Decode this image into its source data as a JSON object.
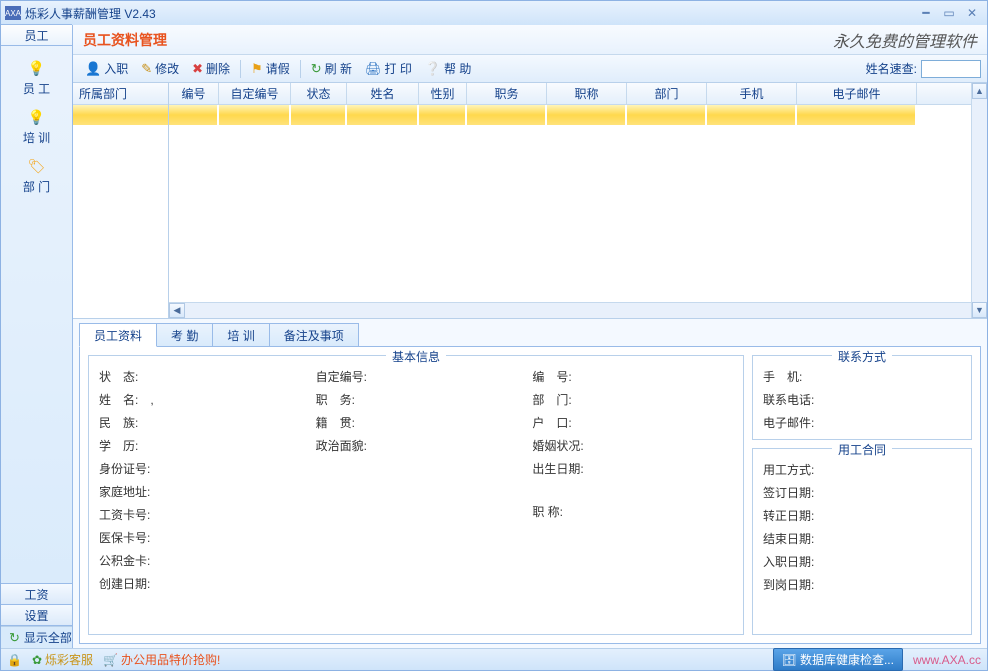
{
  "titlebar": {
    "icon": "AXA",
    "title": "烁彩人事薪酬管理 V2.43"
  },
  "sidebar": {
    "top_tab": "员工",
    "items": [
      {
        "label": "员 工"
      },
      {
        "label": "培 训"
      },
      {
        "label": "部 门"
      }
    ],
    "bottom_tabs": [
      "工资",
      "设置"
    ],
    "show_all": "显示全部"
  },
  "header": {
    "title": "员工资料管理",
    "slogan": "永久免费的管理软件"
  },
  "toolbar": {
    "btns": [
      {
        "label": "入职"
      },
      {
        "label": "修改"
      },
      {
        "label": "删除"
      },
      {
        "label": "请假"
      },
      {
        "label": "刷 新"
      },
      {
        "label": "打 印"
      },
      {
        "label": "帮 助"
      }
    ],
    "search_label": "姓名速查:"
  },
  "grid": {
    "dept_header": "所属部门",
    "columns": [
      "编号",
      "自定编号",
      "状态",
      "姓名",
      "性别",
      "职务",
      "职称",
      "部门",
      "手机",
      "电子邮件"
    ],
    "widths": [
      50,
      72,
      56,
      72,
      48,
      80,
      80,
      80,
      90,
      120
    ]
  },
  "detail": {
    "tabs": [
      "员工资料",
      "考 勤",
      "培 训",
      "备注及事项"
    ],
    "basic_legend": "基本信息",
    "contact_legend": "联系方式",
    "contract_legend": "用工合同",
    "basic": {
      "c1": [
        "状　态:",
        "姓　名:　,",
        "民　族:",
        "学　历:",
        "身份证号:",
        "家庭地址:",
        "工资卡号:",
        "医保卡号:",
        "公积金卡:",
        "创建日期:"
      ],
      "c2": [
        "自定编号:",
        "职　务:",
        "籍　贯:",
        "政治面貌:"
      ],
      "c3": [
        "编　号:",
        "部　门:",
        "户　口:",
        "婚姻状况:",
        "出生日期:",
        "",
        "职 称:"
      ]
    },
    "contact": [
      "手　机:",
      "联系电话:",
      "电子邮件:"
    ],
    "contract": [
      "用工方式:",
      "签订日期:",
      "转正日期:",
      "结束日期:",
      "入职日期:",
      "到岗日期:"
    ]
  },
  "statusbar": {
    "service": "烁彩客服",
    "promo": "办公用品特价抢购!",
    "health": "数据库健康检查...",
    "url": "www.AXA.cc"
  }
}
